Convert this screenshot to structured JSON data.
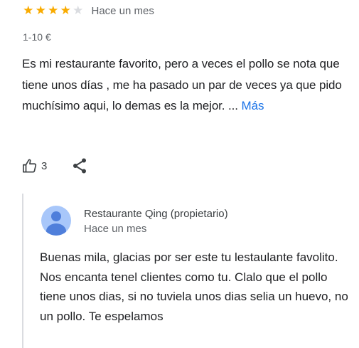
{
  "review": {
    "rating": 4,
    "max_rating": 5,
    "star_color": "#f9ab00",
    "time": "Hace un mes",
    "price_range": "1-10 €",
    "text": "Es mi restaurante favorito, pero a veces el pollo se nota que tiene unos días , me ha pasado un par de veces ya que pido muchísimo aqui, lo demas es la mejor. ...",
    "more_label": "Más",
    "likes": "3",
    "icons": {
      "like": "thumbs-up-icon",
      "share": "share-icon"
    }
  },
  "owner_reply": {
    "name": "Restaurante Qing (propietario)",
    "time": "Hace un mes",
    "text": "Buenas mila, glacias por ser este tu lestaulante favolito. Nos encanta tenel clientes como tu. Clalo que el pollo tiene unos dias, si no tuviela unos dias selia un huevo, no un pollo. Te espelamos",
    "avatar_icon": "person-avatar-icon",
    "avatar_color": "#a8c7fa"
  }
}
